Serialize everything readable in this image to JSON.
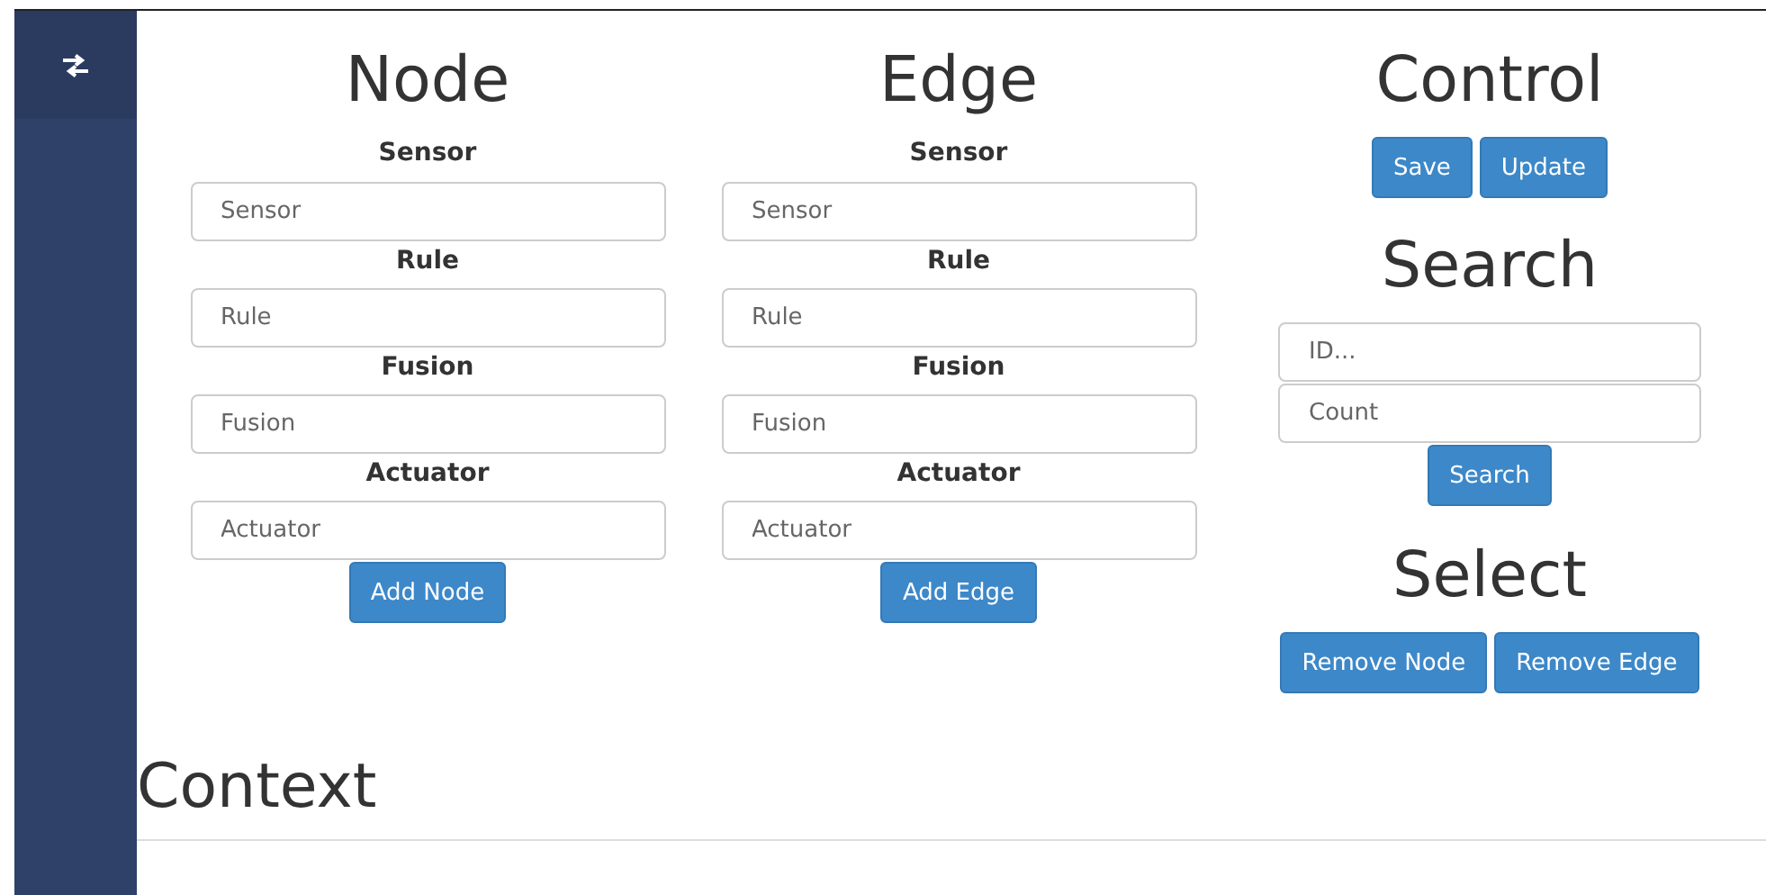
{
  "sections": [
    {
      "title": "Node",
      "fields": [
        {
          "label": "Sensor",
          "placeholder": "Sensor"
        },
        {
          "label": "Rule",
          "placeholder": "Rule"
        },
        {
          "label": "Fusion",
          "placeholder": "Fusion"
        },
        {
          "label": "Actuator",
          "placeholder": "Actuator"
        }
      ],
      "button": "Add Node"
    },
    {
      "title": "Edge",
      "fields": [
        {
          "label": "Sensor",
          "placeholder": "Sensor"
        },
        {
          "label": "Rule",
          "placeholder": "Rule"
        },
        {
          "label": "Fusion",
          "placeholder": "Fusion"
        },
        {
          "label": "Actuator",
          "placeholder": "Actuator"
        }
      ],
      "button": "Add Edge"
    }
  ],
  "control": {
    "title": "Control",
    "buttons": [
      "Save",
      "Update"
    ]
  },
  "search": {
    "title": "Search",
    "fields": [
      {
        "placeholder": "ID..."
      },
      {
        "placeholder": "Count"
      }
    ],
    "button": "Search"
  },
  "select": {
    "title": "Select",
    "buttons": [
      "Remove Node",
      "Remove Edge"
    ]
  },
  "context": {
    "title": "Context"
  }
}
